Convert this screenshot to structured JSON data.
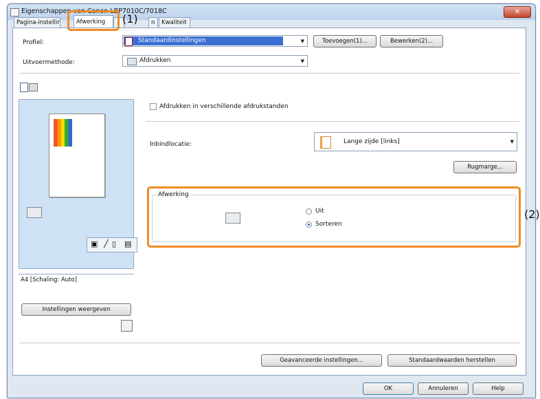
{
  "window": {
    "title": "Eigenschappen van Canon LBP7010C/7018C",
    "close_glyph": "✕"
  },
  "tabs": [
    {
      "label": "Pagina-instellin",
      "active": false
    },
    {
      "label": "Afwerking",
      "active": true
    },
    {
      "label": "",
      "active": false
    },
    {
      "label": "n",
      "active": false
    },
    {
      "label": "Kwaliteit",
      "active": false
    }
  ],
  "callouts": {
    "one": "(1)",
    "two": "(2)"
  },
  "profile": {
    "label": "Profiel:",
    "value": "Standaardinstellingen",
    "add_button": "Toevoegen(1)...",
    "edit_button": "Bewerken(2)..."
  },
  "output_method": {
    "label": "Uitvoermethode:",
    "value": "Afdrukken"
  },
  "preview": {
    "status_text": "A4 [Schaling: Auto]"
  },
  "print_distances_checkbox": {
    "label": "Afdrukken in verschillende afdrukstanden",
    "checked": false
  },
  "binding": {
    "label": "Inbindlocatie:",
    "value": "Lange zijde [links]",
    "margin_button": "Rugmarge..."
  },
  "finishing_group": {
    "title": "Afwerking",
    "options": [
      {
        "label": "Uit",
        "selected": false
      },
      {
        "label": "Sorteren",
        "selected": true
      }
    ]
  },
  "show_settings_button": "Instellingen weergeven",
  "advanced_button": "Geavanceerde instellingen...",
  "restore_defaults_button": "Standaardwaarden herstellen",
  "footer": {
    "ok": "OK",
    "cancel": "Annuleren",
    "help": "Help"
  },
  "colors": {
    "highlight": "#f08a24",
    "selection": "#3b6fd1",
    "panel_border": "#8fa3bd"
  }
}
